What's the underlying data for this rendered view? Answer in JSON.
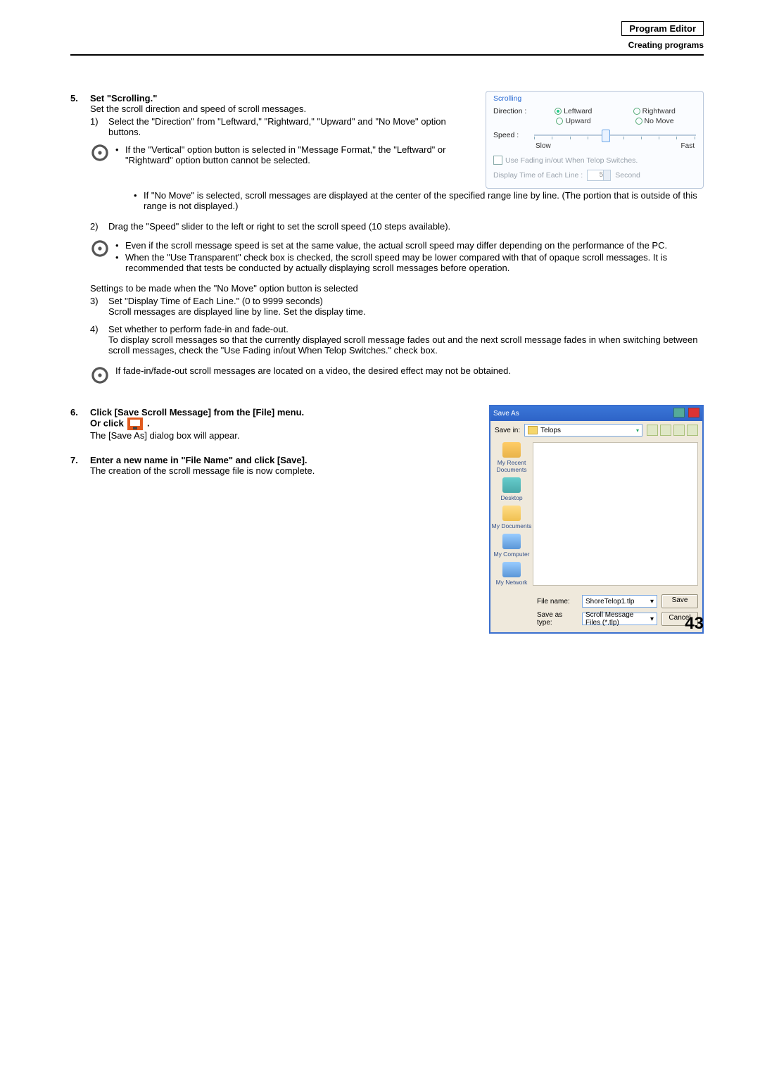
{
  "header": {
    "title": "Program Editor",
    "subtitle": "Creating programs"
  },
  "page_number": "43",
  "step5": {
    "num": "5.",
    "title": "Set \"Scrolling.\"",
    "intro": "Set the scroll direction and speed of scroll messages.",
    "s1_num": "1)",
    "s1": "Select the \"Direction\" from \"Leftward,\" \"Rightward,\" \"Upward\" and \"No Move\" option buttons.",
    "note1_b1": "If the \"Vertical\" option button is selected in \"Message Format,\" the \"Leftward\" or \"Rightward\" option button cannot be selected.",
    "note1_b2": "If \"No Move\" is selected, scroll messages are displayed at the center of the specified range line by line. (The portion that is outside of this range is not displayed.)",
    "s2_num": "2)",
    "s2": "Drag the \"Speed\" slider to the left or right to set the scroll speed (10 steps available).",
    "note2_b1": "Even if the scroll message speed is set at the same value, the actual scroll speed may differ depending on the performance of the PC.",
    "note2_b2": "When the \"Use Transparent\" check box is checked, the scroll speed may be lower compared with that of opaque scroll messages. It is recommended that tests be conducted by actually displaying scroll messages before operation.",
    "nomove_intro": "Settings to be made when the \"No Move\" option button is selected",
    "s3_num": "3)",
    "s3a": "Set \"Display Time of Each Line.\" (0 to 9999 seconds)",
    "s3b": "Scroll messages are displayed line by line. Set the display time.",
    "s4_num": "4)",
    "s4a": "Set whether to perform fade-in and fade-out.",
    "s4b": "To display scroll messages so that the currently displayed scroll message fades out and the next scroll message fades in when switching between scroll messages, check the \"Use Fading in/out When Telop Switches.\" check box.",
    "note3": "If fade-in/fade-out scroll messages are located on a video, the desired effect may not be obtained."
  },
  "scroll_panel": {
    "group": "Scrolling",
    "direction_lbl": "Direction :",
    "leftward": "Leftward",
    "rightward": "Rightward",
    "upward": "Upward",
    "nomove": "No Move",
    "speed_lbl": "Speed :",
    "slow": "Slow",
    "fast": "Fast",
    "fade_chk": "Use Fading in/out When Telop Switches.",
    "disp_line_lbl": "Display Time of Each Line :",
    "disp_val": "5",
    "second": "Second"
  },
  "step6": {
    "num": "6.",
    "title": "Click [Save Scroll Message] from the [File] menu.",
    "or_click": "Or click ",
    "period": " .",
    "body": "The [Save As] dialog box will appear."
  },
  "step7": {
    "num": "7.",
    "title": "Enter a new name in \"File Name\" and click [Save].",
    "body": "The creation of the scroll message file is now complete."
  },
  "saveas": {
    "title": "Save As",
    "savein_lbl": "Save in:",
    "folder": "Telops",
    "places": {
      "recent": "My Recent Documents",
      "desktop": "Desktop",
      "docs": "My Documents",
      "comp": "My Computer",
      "net": "My Network"
    },
    "filename_lbl": "File name:",
    "filename_val": "ShoreTelop1.tlp",
    "saveastype_lbl": "Save as type:",
    "saveastype_val": "Scroll Message Files (*.tlp)",
    "save_btn": "Save",
    "cancel_btn": "Cancel"
  },
  "chart_data": null
}
